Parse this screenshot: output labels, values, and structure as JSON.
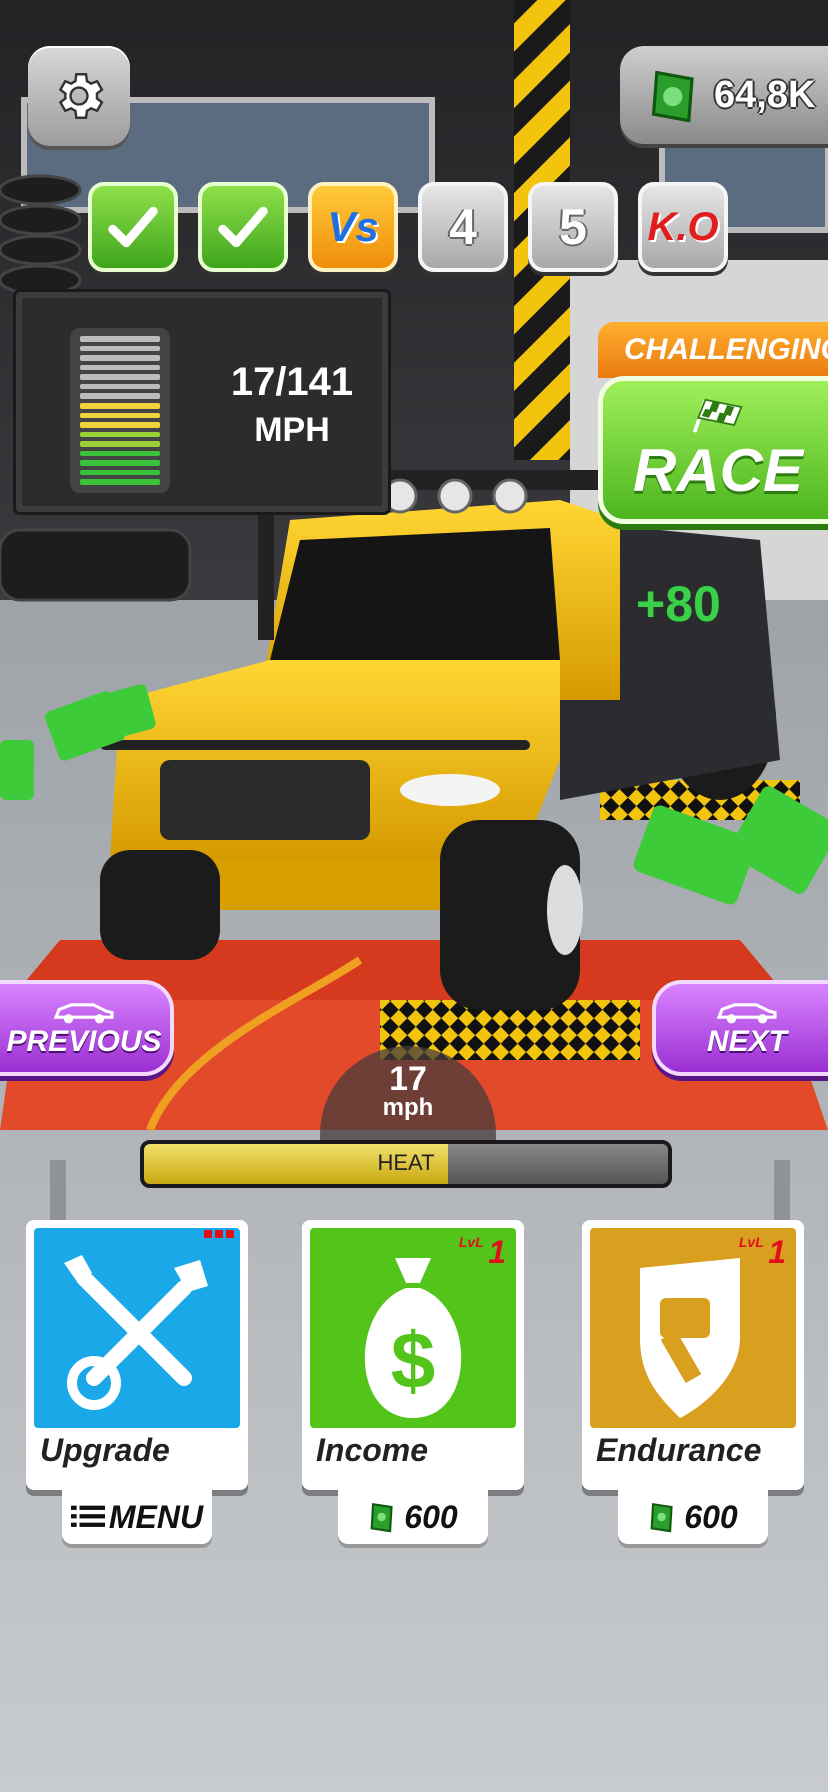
{
  "header": {
    "settings_icon": "gear-icon",
    "money": "64,8K",
    "money_icon": "cash-stack-icon"
  },
  "progress_steps": [
    {
      "type": "done",
      "icon": "checkmark-icon"
    },
    {
      "type": "done",
      "icon": "checkmark-icon"
    },
    {
      "type": "vs",
      "label": "Vs"
    },
    {
      "type": "locked",
      "label": "4"
    },
    {
      "type": "locked",
      "label": "5"
    },
    {
      "type": "ko",
      "label": "K.O"
    }
  ],
  "speed_panel": {
    "value": "17/141",
    "unit": "MPH",
    "gauge_level": 0.55
  },
  "race": {
    "banner": "CHALLENGING",
    "label": "RACE",
    "icon": "checkered-flag-icon"
  },
  "reward_popup": "+80",
  "nav": {
    "previous": "PREVIOUS",
    "next": "NEXT",
    "icon": "car-icon"
  },
  "heat": {
    "speed": "17",
    "speed_unit": "mph",
    "label": "HEAT",
    "level": 0.58
  },
  "cards": [
    {
      "title": "Upgrade",
      "icon": "wrench-screwdriver-icon",
      "button": "MENU",
      "button_icon": "list-icon",
      "color": "#1aa8e8"
    },
    {
      "title": "Income",
      "icon": "money-bag-icon",
      "lvl_prefix": "LvL",
      "lvl": "1",
      "price": "600",
      "price_icon": "cash-icon",
      "color": "#52c41a"
    },
    {
      "title": "Endurance",
      "icon": "shield-hammer-icon",
      "lvl_prefix": "LvL",
      "lvl": "1",
      "price": "600",
      "price_icon": "cash-icon",
      "color": "#d9a020"
    }
  ],
  "colors": {
    "accent_green": "#4db51f",
    "accent_purple": "#9b2fd2",
    "accent_orange": "#ea7a10"
  }
}
